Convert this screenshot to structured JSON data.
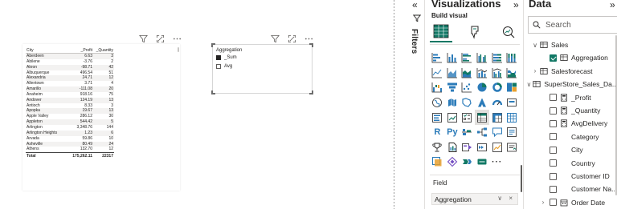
{
  "table": {
    "headers": [
      "City",
      "_Profit",
      "_Quantity"
    ],
    "rows": [
      [
        "Aberdeen",
        "6.63",
        "3"
      ],
      [
        "Abilene",
        "-3.76",
        "2"
      ],
      [
        "Akron",
        "-98.71",
        "42"
      ],
      [
        "Albuquerque",
        "496.54",
        "51"
      ],
      [
        "Alexandria",
        "24.71",
        "12"
      ],
      [
        "Allentown",
        "3.71",
        "4"
      ],
      [
        "Amarillo",
        "-111.08",
        "20"
      ],
      [
        "Anaheim",
        "918.16",
        "75"
      ],
      [
        "Andover",
        "124.19",
        "13"
      ],
      [
        "Antioch",
        "8.33",
        "3"
      ],
      [
        "Apopka",
        "19.67",
        "13"
      ],
      [
        "Apple Valley",
        "286.12",
        "30"
      ],
      [
        "Appleton",
        "544.42",
        "5"
      ],
      [
        "Arlington",
        "3,348.76",
        "144"
      ],
      [
        "Arlington Heights",
        "1.23",
        "6"
      ],
      [
        "Arvada",
        "59.86",
        "10"
      ],
      [
        "Asheville",
        "80.49",
        "24"
      ],
      [
        "Athens",
        "132.70",
        "12"
      ]
    ],
    "total": [
      "Total",
      "175,262.11",
      "22317"
    ]
  },
  "slicer": {
    "title": "Aggregation",
    "options": [
      {
        "label": "_Sum",
        "checked": true
      },
      {
        "label": "Avg",
        "checked": false
      }
    ]
  },
  "visual_header_icons": [
    "filter-icon",
    "focus-mode-icon",
    "more-options-icon"
  ],
  "filters_pane": {
    "label": "Filters",
    "collapse_glyph": "«"
  },
  "visualizations_pane": {
    "title": "Visualizations",
    "expand_glyph": "»",
    "subtitle": "Build visual",
    "field_section_label": "Field",
    "field_well_value": "Aggregation",
    "field_well_controls": "∨ ×",
    "r_label": "R",
    "py_label": "Py",
    "more_label": "···"
  },
  "data_pane": {
    "title": "Data",
    "expand_glyph": "»",
    "search_placeholder": "Search",
    "items": [
      {
        "label": "Sales",
        "chev": "∨",
        "indent": 0,
        "icon": "table-icon"
      },
      {
        "label": "Aggregation",
        "chev": "",
        "indent": 1,
        "icon": "table-icon",
        "checked": true
      },
      {
        "label": "Salesforecast",
        "chev": "›",
        "indent": 0,
        "icon": "table-icon"
      },
      {
        "label": "SuperStore_Sales_Da...",
        "chev": "∨",
        "indent": 0,
        "icon": "table-icon"
      },
      {
        "label": "_Profit",
        "chev": "",
        "indent": 1,
        "icon": "calculator-icon",
        "checked": false
      },
      {
        "label": "_Quantity",
        "chev": "",
        "indent": 1,
        "icon": "calculator-icon",
        "checked": false
      },
      {
        "label": "AvgDelivery",
        "chev": "",
        "indent": 1,
        "icon": "calculator-icon",
        "checked": false
      },
      {
        "label": "Category",
        "chev": "",
        "indent": 1,
        "icon": "",
        "checked": false
      },
      {
        "label": "City",
        "chev": "",
        "indent": 1,
        "icon": "",
        "checked": false
      },
      {
        "label": "Country",
        "chev": "",
        "indent": 1,
        "icon": "",
        "checked": false
      },
      {
        "label": "Customer ID",
        "chev": "",
        "indent": 1,
        "icon": "",
        "checked": false
      },
      {
        "label": "Customer Na...",
        "chev": "",
        "indent": 1,
        "icon": "",
        "checked": false
      },
      {
        "label": "Order Date",
        "chev": "›",
        "indent": 1,
        "icon": "calendar-icon",
        "checked": false
      }
    ]
  },
  "colors": {
    "accent": "#117865",
    "chart_blue": "#2b7bb9",
    "chart_teal": "#117865",
    "chart_orange": "#e8a02e",
    "chart_purple": "#744ec2"
  }
}
